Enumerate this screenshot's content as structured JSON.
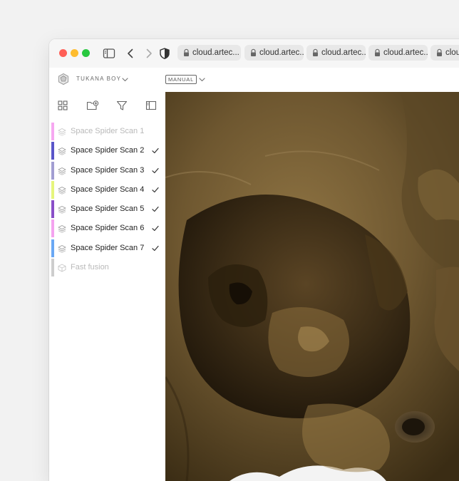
{
  "browser": {
    "traffic_lights": [
      "#ff5f57",
      "#febc2e",
      "#28c840"
    ],
    "tabs": [
      {
        "label": "cloud.artec..."
      },
      {
        "label": "cloud.artec..."
      },
      {
        "label": "cloud.artec..."
      },
      {
        "label": "cloud.artec..."
      },
      {
        "label": "clou"
      }
    ]
  },
  "header": {
    "project_name": "TUKANA BOY",
    "mode": "MANUAL"
  },
  "toolbar": {
    "icons": [
      "grid-icon",
      "add-folder-icon",
      "filter-icon",
      "panel-icon"
    ]
  },
  "scans": [
    {
      "name": "Space Spider Scan 1",
      "color": "#f6a8f1",
      "active": false,
      "checked": false
    },
    {
      "name": "Space Spider Scan 2",
      "color": "#5a55c9",
      "active": true,
      "checked": true
    },
    {
      "name": "Space Spider Scan 3",
      "color": "#a29ed2",
      "active": true,
      "checked": true
    },
    {
      "name": "Space Spider Scan 4",
      "color": "#e6f57c",
      "active": true,
      "checked": true
    },
    {
      "name": "Space Spider Scan 5",
      "color": "#8a4fc8",
      "active": true,
      "checked": true
    },
    {
      "name": "Space Spider Scan 6",
      "color": "#f4a3ef",
      "active": true,
      "checked": true
    },
    {
      "name": "Space Spider Scan 7",
      "color": "#6aa8f4",
      "active": true,
      "checked": true
    },
    {
      "name": "Fast fusion",
      "color": "#cdcdcd",
      "active": false,
      "checked": false
    }
  ]
}
